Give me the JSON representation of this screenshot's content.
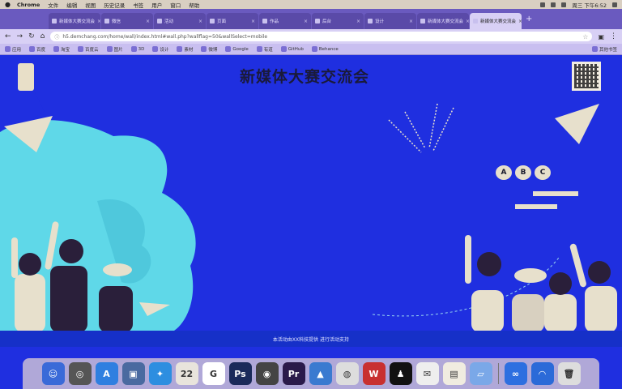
{
  "menubar": {
    "app_name": "Chrome",
    "menus": [
      "文件",
      "编辑",
      "视图",
      "历史记录",
      "书签",
      "用户",
      "窗口",
      "帮助"
    ],
    "clock": "周三 下午6:52"
  },
  "tabs": [
    {
      "label": "新媒体大赛交流会"
    },
    {
      "label": "微信"
    },
    {
      "label": "活动"
    },
    {
      "label": "页面"
    },
    {
      "label": "作品"
    },
    {
      "label": "后台"
    },
    {
      "label": "设计"
    },
    {
      "label": "新媒体大赛交流会"
    },
    {
      "label": "新媒体大赛交流会"
    }
  ],
  "toolbar": {
    "url": "h5.demchang.com/home/wall/index.html#wall.php?wallflag=50&wallSelect=mobile",
    "back_glyph": "←",
    "forward_glyph": "→",
    "reload_glyph": "↻",
    "home_glyph": "⌂",
    "star_glyph": "☆",
    "menu_glyph": "⋮"
  },
  "bookmarks": [
    {
      "label": "应用"
    },
    {
      "label": "百度"
    },
    {
      "label": "淘宝"
    },
    {
      "label": "百度云"
    },
    {
      "label": "图片"
    },
    {
      "label": "3D"
    },
    {
      "label": "设计"
    },
    {
      "label": "素材"
    },
    {
      "label": "微博"
    },
    {
      "label": "Google"
    },
    {
      "label": "有道"
    },
    {
      "label": "GitHub"
    },
    {
      "label": "Behance"
    },
    {
      "label": "其他书签"
    }
  ],
  "page": {
    "title": "新媒体大赛交流会",
    "footer": "本活动由XX科技提供 进行活动支持",
    "abc": [
      "A",
      "B",
      "C"
    ]
  },
  "dock": [
    {
      "icon": "finder-icon",
      "glyph": "☺",
      "color": "#3a6ad8"
    },
    {
      "icon": "launchpad-icon",
      "glyph": "◎",
      "color": "#555"
    },
    {
      "icon": "app-store-icon",
      "glyph": "A",
      "color": "#2f7fe0"
    },
    {
      "icon": "preview-icon",
      "glyph": "▣",
      "color": "#4a6aa0"
    },
    {
      "icon": "safari-icon",
      "glyph": "✦",
      "color": "#2d8ee0"
    },
    {
      "icon": "calendar-icon",
      "glyph": "22",
      "color": "#e8e4dc"
    },
    {
      "icon": "itunes-icon",
      "glyph": "G",
      "color": "#ffffff"
    },
    {
      "icon": "photoshop-icon",
      "glyph": "Ps",
      "color": "#1a2a5a"
    },
    {
      "icon": "compass-icon",
      "glyph": "◉",
      "color": "#444"
    },
    {
      "icon": "premiere-icon",
      "glyph": "Pr",
      "color": "#2a1a4a"
    },
    {
      "icon": "keynote-icon",
      "glyph": "▲",
      "color": "#3a7ad0"
    },
    {
      "icon": "chrome-icon",
      "glyph": "◍",
      "color": "#ddd"
    },
    {
      "icon": "wps-icon",
      "glyph": "W",
      "color": "#c83030"
    },
    {
      "icon": "qq-icon",
      "glyph": "♟",
      "color": "#111"
    },
    {
      "icon": "wechat-icon",
      "glyph": "✉",
      "color": "#eee"
    },
    {
      "icon": "notes-icon",
      "glyph": "▤",
      "color": "#f0ece0"
    },
    {
      "icon": "folder-icon",
      "glyph": "▱",
      "color": "#7aa8e8"
    },
    {
      "icon": "baidu-netdisk-icon",
      "glyph": "∞",
      "color": "#2d6fe0"
    },
    {
      "icon": "downloads-icon",
      "glyph": "◠",
      "color": "#2b6ad8"
    },
    {
      "icon": "trash-icon",
      "glyph": "🗑",
      "color": "#ddd"
    }
  ]
}
